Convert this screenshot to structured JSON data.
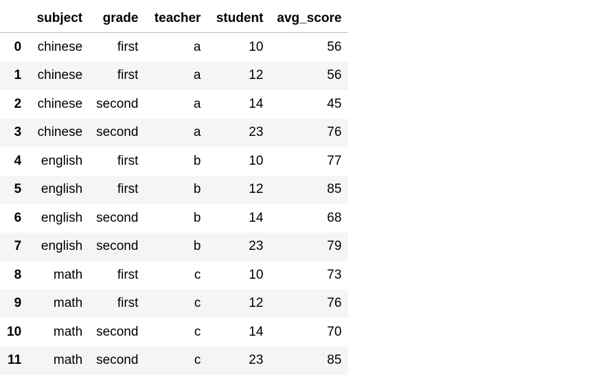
{
  "table": {
    "columns": [
      "",
      "subject",
      "grade",
      "teacher",
      "student",
      "avg_score"
    ],
    "rows": [
      {
        "index": "0",
        "subject": "chinese",
        "grade": "first",
        "teacher": "a",
        "student": "10",
        "avg_score": "56"
      },
      {
        "index": "1",
        "subject": "chinese",
        "grade": "first",
        "teacher": "a",
        "student": "12",
        "avg_score": "56"
      },
      {
        "index": "2",
        "subject": "chinese",
        "grade": "second",
        "teacher": "a",
        "student": "14",
        "avg_score": "45"
      },
      {
        "index": "3",
        "subject": "chinese",
        "grade": "second",
        "teacher": "a",
        "student": "23",
        "avg_score": "76"
      },
      {
        "index": "4",
        "subject": "english",
        "grade": "first",
        "teacher": "b",
        "student": "10",
        "avg_score": "77"
      },
      {
        "index": "5",
        "subject": "english",
        "grade": "first",
        "teacher": "b",
        "student": "12",
        "avg_score": "85"
      },
      {
        "index": "6",
        "subject": "english",
        "grade": "second",
        "teacher": "b",
        "student": "14",
        "avg_score": "68"
      },
      {
        "index": "7",
        "subject": "english",
        "grade": "second",
        "teacher": "b",
        "student": "23",
        "avg_score": "79"
      },
      {
        "index": "8",
        "subject": "math",
        "grade": "first",
        "teacher": "c",
        "student": "10",
        "avg_score": "73"
      },
      {
        "index": "9",
        "subject": "math",
        "grade": "first",
        "teacher": "c",
        "student": "12",
        "avg_score": "76"
      },
      {
        "index": "10",
        "subject": "math",
        "grade": "second",
        "teacher": "c",
        "student": "14",
        "avg_score": "70"
      },
      {
        "index": "11",
        "subject": "math",
        "grade": "second",
        "teacher": "c",
        "student": "23",
        "avg_score": "85"
      }
    ]
  },
  "colors": {
    "stripe": "#f5f5f5",
    "header_rule": "#bdbdbd",
    "text": "#000000"
  }
}
